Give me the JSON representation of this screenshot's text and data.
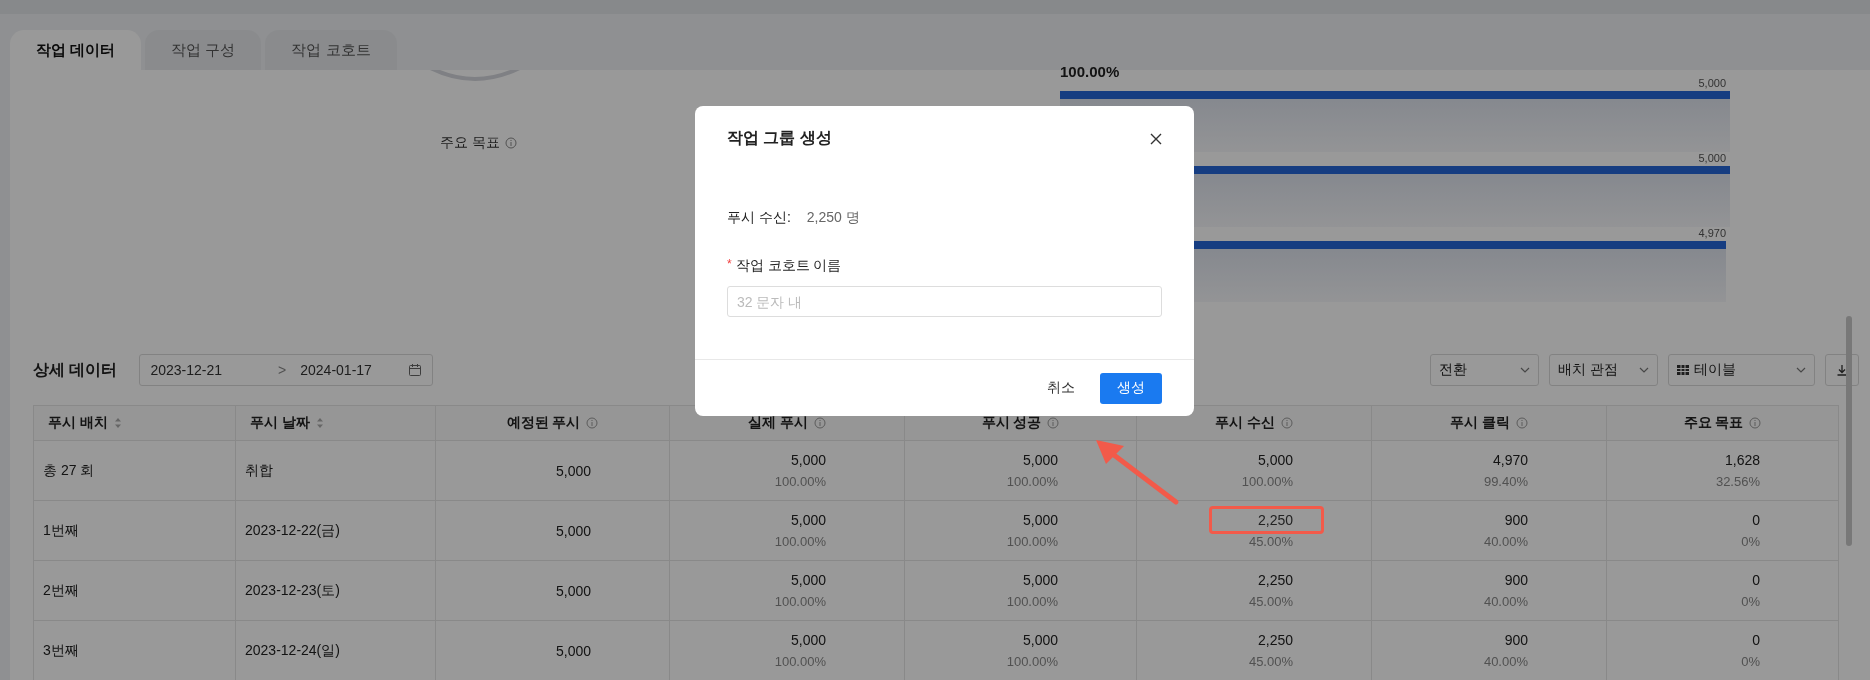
{
  "tabs": [
    {
      "label": "작업 데이터",
      "selected": true
    },
    {
      "label": "작업 구성",
      "selected": false
    },
    {
      "label": "작업 코호트",
      "selected": false
    }
  ],
  "funnel": {
    "goal_label": "주요 목표",
    "top_label": "100.00%",
    "bars": [
      {
        "value": "5,000",
        "level": 1
      },
      {
        "value": "5,000",
        "level": 1
      },
      {
        "value": "4,970",
        "level": 0.994
      }
    ]
  },
  "detail": {
    "title": "상세 데이터",
    "date_start": "2023-12-21",
    "date_separator": ">",
    "date_end": "2024-01-17",
    "selects": [
      {
        "label": "전환",
        "kind": "plain"
      },
      {
        "label": "배치 관점",
        "kind": "plain"
      },
      {
        "label": "테이블",
        "kind": "view"
      }
    ]
  },
  "table": {
    "columns": [
      {
        "label": "푸시 배치",
        "kind": "sort"
      },
      {
        "label": "푸시 날짜",
        "kind": "sort"
      },
      {
        "label": "예정된 푸시",
        "kind": "info"
      },
      {
        "label": "실제 푸시",
        "kind": "info"
      },
      {
        "label": "푸시 성공",
        "kind": "info"
      },
      {
        "label": "푸시 수신",
        "kind": "info"
      },
      {
        "label": "푸시 클릭",
        "kind": "info"
      },
      {
        "label": "주요 목표",
        "kind": "info"
      }
    ],
    "rows": [
      {
        "batch": "총 27 회",
        "date": "취합",
        "metrics": [
          {
            "value": "5,000",
            "marked": false
          },
          {
            "value": "5,000",
            "percent": "100.00%",
            "marked": false
          },
          {
            "value": "5,000",
            "percent": "100.00%",
            "marked": false
          },
          {
            "value": "5,000",
            "percent": "100.00%",
            "marked": false
          },
          {
            "value": "4,970",
            "percent": "99.40%",
            "marked": false
          },
          {
            "value": "1,628",
            "percent": "32.56%",
            "marked": false
          }
        ]
      },
      {
        "batch": "1번째",
        "date": "2023-12-22(금)",
        "metrics": [
          {
            "value": "5,000",
            "marked": false
          },
          {
            "value": "5,000",
            "percent": "100.00%",
            "marked": false
          },
          {
            "value": "5,000",
            "percent": "100.00%",
            "marked": false
          },
          {
            "value": "2,250",
            "percent": "45.00%",
            "marked": true
          },
          {
            "value": "900",
            "percent": "40.00%",
            "marked": false
          },
          {
            "value": "0",
            "percent": "0%",
            "marked": false
          }
        ]
      },
      {
        "batch": "2번째",
        "date": "2023-12-23(토)",
        "metrics": [
          {
            "value": "5,000",
            "marked": false
          },
          {
            "value": "5,000",
            "percent": "100.00%",
            "marked": false
          },
          {
            "value": "5,000",
            "percent": "100.00%",
            "marked": false
          },
          {
            "value": "2,250",
            "percent": "45.00%",
            "marked": false
          },
          {
            "value": "900",
            "percent": "40.00%",
            "marked": false
          },
          {
            "value": "0",
            "percent": "0%",
            "marked": false
          }
        ]
      },
      {
        "batch": "3번째",
        "date": "2023-12-24(일)",
        "metrics": [
          {
            "value": "5,000",
            "marked": false
          },
          {
            "value": "5,000",
            "percent": "100.00%",
            "marked": false
          },
          {
            "value": "5,000",
            "percent": "100.00%",
            "marked": false
          },
          {
            "value": "2,250",
            "percent": "45.00%",
            "marked": false
          },
          {
            "value": "900",
            "percent": "40.00%",
            "marked": false
          },
          {
            "value": "0",
            "percent": "0%",
            "marked": false
          }
        ]
      }
    ]
  },
  "modal": {
    "title": "작업 그룹 생성",
    "info_label": "푸시 수신:",
    "info_value": "2,250 명",
    "field": {
      "label": "작업 코호트 이름",
      "required_mark": "*",
      "placeholder": "32 문자 내"
    },
    "buttons": [
      {
        "label": "취소",
        "kind": "secondary"
      },
      {
        "label": "생성",
        "kind": "primary"
      }
    ]
  }
}
